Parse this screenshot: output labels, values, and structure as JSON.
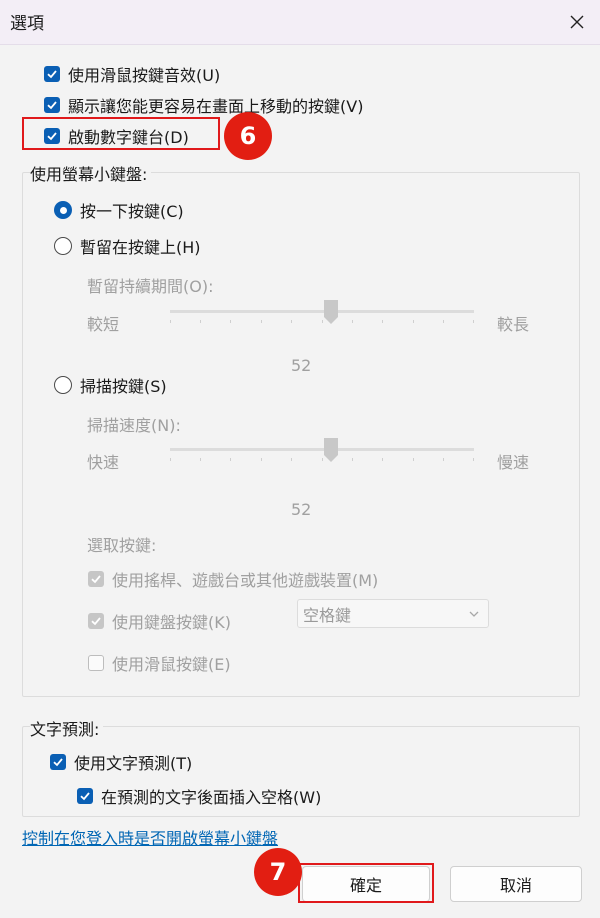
{
  "window": {
    "title": "選項"
  },
  "options": {
    "mouse_sound": "使用滑鼠按鍵音效(U)",
    "easy_move": "顯示讓您能更容易在畫面上移動的按鍵(V)",
    "numpad": "啟動數字鍵台(D)"
  },
  "keyboard_mode": {
    "group_label": "使用螢幕小鍵盤:",
    "click": "按一下按鍵(C)",
    "hover": "暫留在按鍵上(H)",
    "hover_duration_label": "暫留持續期間(O):",
    "hover_min": "較短",
    "hover_max": "較長",
    "hover_value": "52",
    "scan": "掃描按鍵(S)",
    "scan_speed_label": "掃描速度(N):",
    "scan_min": "快速",
    "scan_max": "慢速",
    "scan_value": "52",
    "select_keys_label": "選取按鍵:",
    "joystick": "使用搖桿、遊戲台或其他遊戲裝置(M)",
    "keyboard_key": "使用鍵盤按鍵(K)",
    "keyboard_key_select": "空格鍵",
    "mouse_key": "使用滑鼠按鍵(E)"
  },
  "prediction": {
    "group_label": "文字預測:",
    "use": "使用文字預測(T)",
    "space": "在預測的文字後面插入空格(W)"
  },
  "footer": {
    "link": "控制在您登入時是否開啟螢幕小鍵盤",
    "ok": "確定",
    "cancel": "取消"
  },
  "annotations": {
    "step6": "6",
    "step7": "7"
  },
  "colors": {
    "accent": "#0a5fb4",
    "highlight": "#e0191b",
    "badge": "#e21e12"
  },
  "icons": {
    "close": "close-icon",
    "check": "check-icon",
    "dropdown": "chevron-down-icon"
  }
}
